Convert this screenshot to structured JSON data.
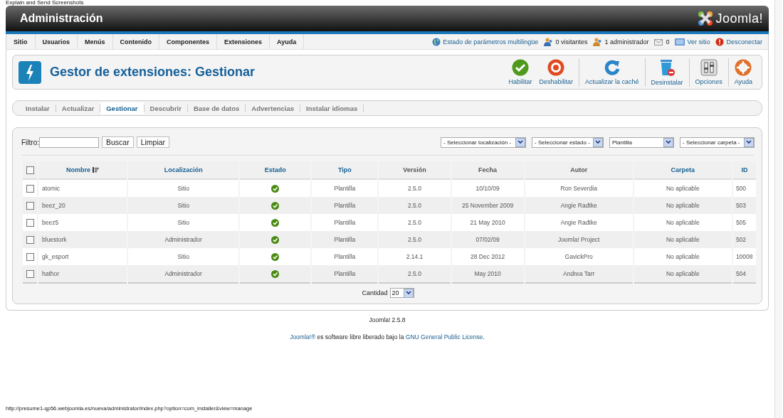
{
  "capture_tool_label": "Explain and Send Screenshots",
  "header": {
    "title": "Administración",
    "logo_text": "Joomla!"
  },
  "menu": [
    "Sitio",
    "Usuarios",
    "Menús",
    "Contenido",
    "Componentes",
    "Extensiones",
    "Ayuda"
  ],
  "status_items": [
    {
      "kind": "globe",
      "label": "Estado de parámetros multilingüe",
      "link": true
    },
    {
      "kind": "users",
      "label": "0 visitantes",
      "link": false
    },
    {
      "kind": "admins",
      "label": "1 administrador",
      "link": false
    },
    {
      "kind": "mail",
      "label": "0",
      "link": false
    },
    {
      "kind": "site",
      "label": "Ver sitio",
      "link": true
    },
    {
      "kind": "logout",
      "label": "Desconectar",
      "link": true
    }
  ],
  "page_title": "Gestor de extensiones: Gestionar",
  "toolbar": [
    {
      "kind": "enable",
      "label": "Habilitar",
      "divider_before": false
    },
    {
      "kind": "disable",
      "label": "Deshabilitar",
      "divider_before": false
    },
    {
      "kind": "refresh",
      "label": "Actualizar la caché",
      "divider_before": true
    },
    {
      "kind": "trash",
      "label": "Desinstalar",
      "divider_before": true
    },
    {
      "kind": "options",
      "label": "Opciones",
      "divider_before": true
    },
    {
      "kind": "help",
      "label": "Ayuda",
      "divider_before": true
    }
  ],
  "subtabs": [
    {
      "label": "Instalar",
      "selected": false
    },
    {
      "label": "Actualizar",
      "selected": false
    },
    {
      "label": "Gestionar",
      "selected": true
    },
    {
      "label": "Descubrir",
      "selected": false
    },
    {
      "label": "Base de datos",
      "selected": false
    },
    {
      "label": "Advertencias",
      "selected": false
    },
    {
      "label": "Instalar idiomas",
      "selected": false
    }
  ],
  "filter": {
    "label": "Filtro:",
    "search_button": "Buscar",
    "clear_button": "Limpiar"
  },
  "selects": [
    "- Seleccionar localización -",
    "- Seleccionar estado -",
    "Plantilla",
    "- Seleccionar carpeta -"
  ],
  "table": {
    "select_all_checked": false,
    "columns": [
      {
        "label": "Nombre",
        "sortable": true,
        "sorted": true
      },
      {
        "label": "Localización",
        "sortable": true,
        "sorted": false
      },
      {
        "label": "Estado",
        "sortable": true,
        "sorted": false
      },
      {
        "label": "Tipo",
        "sortable": true,
        "sorted": false
      },
      {
        "label": "Versión",
        "sortable": false,
        "sorted": false
      },
      {
        "label": "Fecha",
        "sortable": false,
        "sorted": false
      },
      {
        "label": "Autor",
        "sortable": false,
        "sorted": false
      },
      {
        "label": "Carpeta",
        "sortable": true,
        "sorted": false
      },
      {
        "label": "ID",
        "sortable": true,
        "sorted": false
      }
    ],
    "rows": [
      {
        "checked": false,
        "enabled": true,
        "cells": [
          "atomic",
          "Sitio",
          "",
          "Plantilla",
          "2.5.0",
          "10/10/09",
          "Ron Severdia",
          "No aplicable",
          "500"
        ]
      },
      {
        "checked": false,
        "enabled": true,
        "cells": [
          "beez_20",
          "Sitio",
          "",
          "Plantilla",
          "2.5.0",
          "25 November 2009",
          "Angie Radtke",
          "No aplicable",
          "503"
        ]
      },
      {
        "checked": false,
        "enabled": true,
        "cells": [
          "beez5",
          "Sitio",
          "",
          "Plantilla",
          "2.5.0",
          "21 May 2010",
          "Angie Radtke",
          "No aplicable",
          "505"
        ]
      },
      {
        "checked": false,
        "enabled": true,
        "cells": [
          "bluestork",
          "Administrador",
          "",
          "Plantilla",
          "2.5.0",
          "07/02/09",
          "Joomla! Project",
          "No aplicable",
          "502"
        ]
      },
      {
        "checked": false,
        "enabled": true,
        "cells": [
          "gk_esport",
          "Sitio",
          "",
          "Plantilla",
          "2.14.1",
          "28 Dec 2012",
          "GavickPro",
          "No aplicable",
          "10008"
        ]
      },
      {
        "checked": false,
        "enabled": true,
        "cells": [
          "hathor",
          "Administrador",
          "",
          "Plantilla",
          "2.5.0",
          "May 2010",
          "Andrea Tarr",
          "No aplicable",
          "504"
        ]
      }
    ]
  },
  "pagination": {
    "label": "Cantidad",
    "value": "20"
  },
  "footer": {
    "version": "Joomla! 2.5.8",
    "license_link_1": "Joomla!®",
    "license_text": " es software libre liberado bajo la ",
    "license_link_2": "GNU General Public License",
    "license_end": "."
  },
  "status_url": "http://presume1-qp56.webjoomla.es/nueva/administrator/index.php?option=com_installer&view=manage"
}
